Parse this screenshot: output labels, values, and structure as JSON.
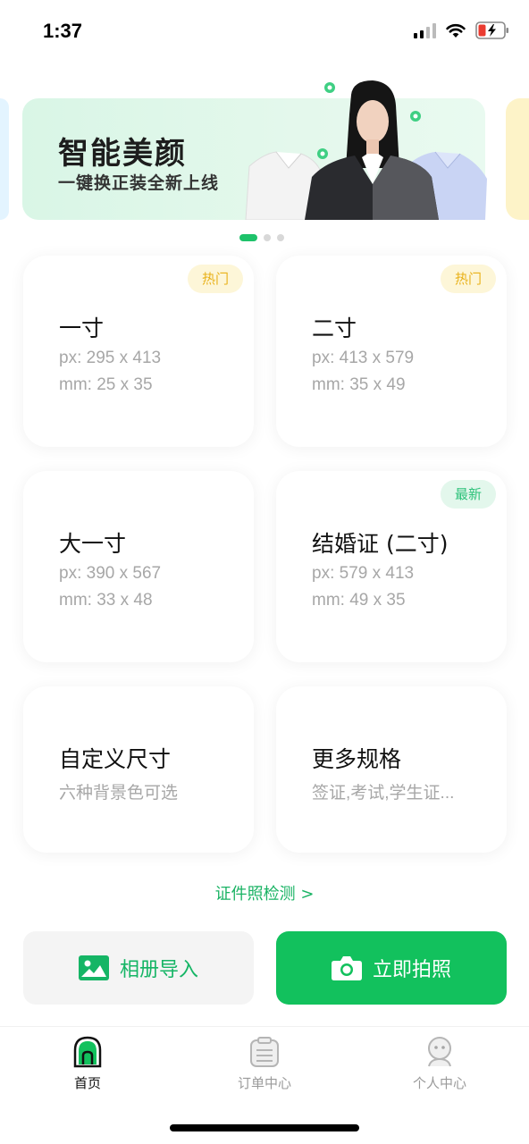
{
  "status_bar": {
    "time": "1:37"
  },
  "banner": {
    "title": "智能美颜",
    "subtitle": "一键换正装全新上线",
    "dots": 3,
    "active_dot": 0
  },
  "cards": [
    {
      "title": "一寸",
      "line1": "px: 295 x 413",
      "line2": "mm: 25 x 35",
      "badge": "热门"
    },
    {
      "title": "二寸",
      "line1": "px: 413 x 579",
      "line2": "mm: 35 x 49",
      "badge": "热门"
    },
    {
      "title": "大一寸",
      "line1": "px: 390 x 567",
      "line2": "mm: 33 x 48"
    },
    {
      "title": "结婚证 (二寸)",
      "line1": "px: 579 x 413",
      "line2": "mm: 49 x 35",
      "badge": "最新"
    },
    {
      "title": "自定义尺寸",
      "line1": "六种背景色可选"
    },
    {
      "title": "更多规格",
      "line1": "签证,考试,学生证..."
    }
  ],
  "detect_link": "证件照检测 >",
  "buttons": {
    "album": "相册导入",
    "shoot": "立即拍照"
  },
  "tabs": [
    {
      "label": "首页",
      "icon": "home-icon"
    },
    {
      "label": "订单中心",
      "icon": "clipboard-icon"
    },
    {
      "label": "个人中心",
      "icon": "profile-icon"
    }
  ],
  "colors": {
    "accent": "#12C15D",
    "hot_badge": "#E9B21A",
    "new_badge": "#2EC27A"
  }
}
